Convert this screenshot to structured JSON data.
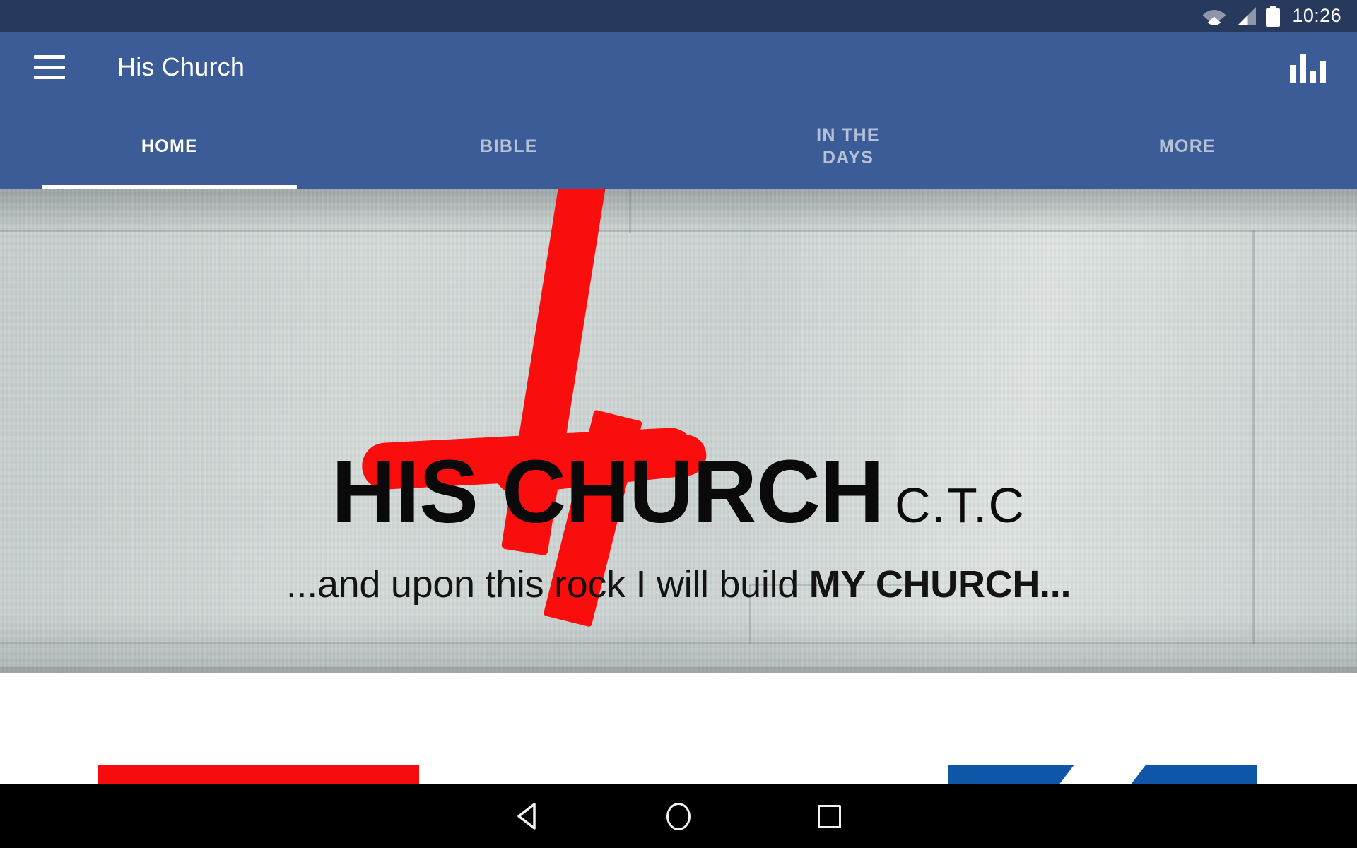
{
  "status_bar": {
    "time": "10:26",
    "icons": [
      "wifi-icon",
      "signal-icon",
      "battery-icon"
    ]
  },
  "app_bar": {
    "menu_icon": "hamburger-menu-icon",
    "title": "His Church",
    "action_icon": "bar-chart-icon"
  },
  "tabs": [
    {
      "label": "HOME",
      "active": true
    },
    {
      "label": "BIBLE",
      "active": false
    },
    {
      "label": "IN THE\nDAYS",
      "active": false
    },
    {
      "label": "MORE",
      "active": false
    }
  ],
  "banner": {
    "headline": "HIS CHURCH",
    "suffix": "C.T.C",
    "tagline_prefix": "...and upon this rock I will build ",
    "tagline_emphasis": "MY CHURCH...",
    "graphic": "red-cross-icon"
  },
  "content_cards": [
    {
      "name": "card-red",
      "color": "#f60c0c"
    },
    {
      "name": "card-blue-1",
      "color": "#0f56a9"
    },
    {
      "name": "card-blue-2",
      "color": "#0f56a9"
    }
  ],
  "nav_bar": {
    "back": "back-triangle-icon",
    "home": "home-circle-icon",
    "recents": "recents-square-icon"
  },
  "colors": {
    "status_bar": "#27395c",
    "app_bar": "#3b5c96",
    "accent_red": "#fa0d0d",
    "accent_blue": "#0f56a9",
    "tab_active": "#ffffff",
    "tab_inactive": "rgba(255,255,255,0.62)"
  }
}
